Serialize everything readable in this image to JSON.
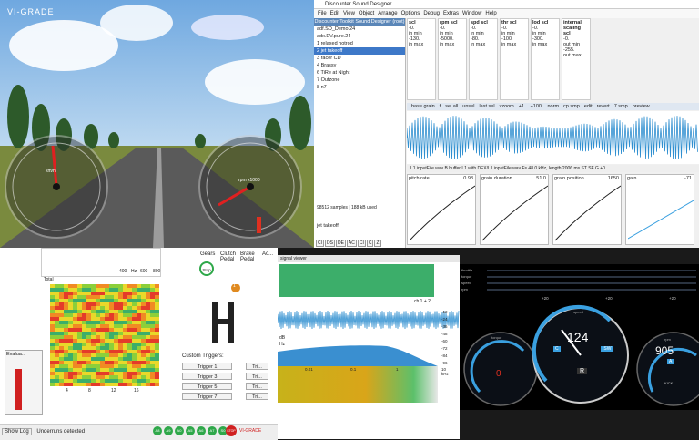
{
  "sim": {
    "logo": "VI-GRADE",
    "speed_gauge_unit": "km/h",
    "rpm_gauge_unit": "rpm x1000"
  },
  "designer": {
    "title": "Discounter Sound Designer",
    "menu": [
      "File",
      "Edit",
      "View",
      "Object",
      "Arrange",
      "Options",
      "Debug",
      "Extras",
      "Window",
      "Help"
    ],
    "list_header": "Discounter Toolkit Sound Designer (root)",
    "file1": "adf.SD_Demo.24",
    "file2": "adx.EV.pure.24",
    "presets": [
      "1 relaxed hotrod",
      "2 jet takeoff",
      "3 racer CD",
      "4 Brassy",
      "6 TiRe at Night",
      "7 Outzone",
      "8 n7"
    ],
    "selected_index": 1,
    "column_labels": [
      "scl",
      "rpm scl",
      "spd scl",
      "thr scl",
      "lod scl",
      "internal scaling scl"
    ],
    "column_values": [
      [
        "-0.",
        "in min",
        "-130.",
        "in max"
      ],
      [
        "-0.",
        "in min",
        "-5000.",
        "in max"
      ],
      [
        "-0.",
        "in min",
        "-80.",
        "in max"
      ],
      [
        "-0.",
        "in min",
        "-100.",
        "in max"
      ],
      [
        "-0.",
        "in min",
        "-300.",
        "in max"
      ],
      [
        "-0.",
        "out min",
        "-255.",
        "out max"
      ]
    ],
    "wave_toolbar": [
      "base grain",
      "f",
      "sel all",
      "unsel",
      "last sel",
      "vzoom",
      "+1.",
      "+100.",
      "norm",
      "cp smp",
      "edit",
      "revert",
      "7 smp",
      "preview"
    ],
    "buffer_line": "L1.inputFile.wav   B   buffer L1 with DFX/L1.inputFile.wav Fs 48.0 kHz, length 2006 ms  ST SF G +0",
    "samples": "98512 samples | 188 kB used",
    "jet_label": "jet takeoff",
    "curves": [
      {
        "title": "pitch rate",
        "value": "0.98"
      },
      {
        "title": "grain duration",
        "value": "51.0"
      },
      {
        "title": "grain position",
        "value": "1650"
      },
      {
        "title": "gain",
        "value": "-71"
      }
    ],
    "bottom_buttons": [
      "CI",
      "DS",
      "DE",
      "AC",
      "CI",
      "C",
      "Z"
    ]
  },
  "monitor": {
    "hz_label": "Hz",
    "freq_ticks": [
      "400",
      "600",
      "800"
    ],
    "legend_total": "Total",
    "evaluate_label": "Evalua...",
    "gears_label": "Gears",
    "stop_label": "Stop",
    "gear_indicator": "1",
    "pedals": [
      "Clutch Pedal",
      "Brake Pedal",
      "Ac..."
    ],
    "custom_triggers_label": "Custom Triggers:",
    "triggers": [
      "Trigger 1",
      "Trigger 3",
      "Trigger 5",
      "Trigger 7"
    ],
    "trig_right": "Tri...",
    "x_ticks": [
      "4",
      "8",
      "12",
      "16"
    ],
    "show_log": "Show Log",
    "status": "Underruns detected",
    "status_dots": [
      "A8",
      "A9",
      "A0",
      "A5",
      "A6",
      "A7",
      "S0"
    ],
    "stop_badge": "STOP",
    "brand": "VI-GRADE"
  },
  "audio": {
    "title": "signal viewer",
    "channel_label": "ch 1 + 2",
    "db_ticks": [
      "-12",
      "-24",
      "-36",
      "-48",
      "-60",
      "-72",
      "-84",
      "-96"
    ],
    "freq_labels": [
      "0.01",
      "0.1",
      "1",
      "10 kHz"
    ],
    "scale_labels": [
      "dB",
      "Hz"
    ]
  },
  "dash": {
    "bars": [
      "throttle",
      "torque",
      "speed",
      "rpm"
    ],
    "top_ticks": [
      "+20",
      "+20",
      "+20"
    ],
    "left_value": "0",
    "center_value": "124",
    "right_value": "905",
    "center_gear": "R",
    "left_label": "torque",
    "center_label": "speed",
    "right_label": "rpm",
    "center_badge_left": "C",
    "center_badge_right": "ISW",
    "right_badge": "A",
    "right_bottom": "KICK"
  },
  "colors": {
    "accent": "#3d78c8",
    "wave": "#2f8fd0",
    "green": "#2fa84a",
    "dash_blue": "#3aa0e0"
  }
}
